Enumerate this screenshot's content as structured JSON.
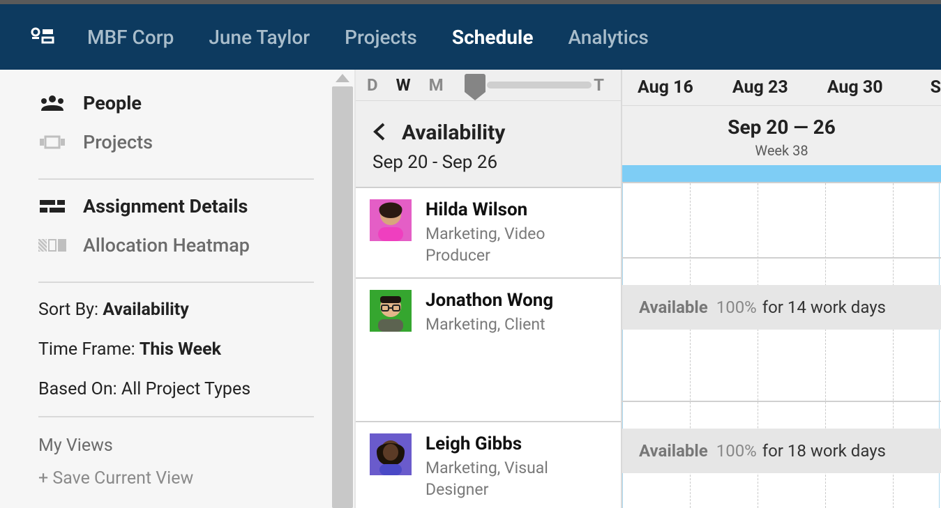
{
  "topnav": {
    "items": [
      {
        "label": "MBF Corp"
      },
      {
        "label": "June Taylor"
      },
      {
        "label": "Projects"
      },
      {
        "label": "Schedule",
        "active": true
      },
      {
        "label": "Analytics"
      }
    ]
  },
  "sidebar": {
    "items": [
      {
        "label": "People",
        "active": true
      },
      {
        "label": "Projects"
      },
      {
        "label": "Assignment Details",
        "active": true
      },
      {
        "label": "Allocation Heatmap"
      }
    ],
    "sort": {
      "label": "Sort By: ",
      "value": "Availability"
    },
    "timeframe": {
      "label": "Time Frame: ",
      "value": "This Week"
    },
    "basedon": {
      "label": "Based On: All Project Types"
    },
    "myviews": "My Views",
    "save": "+ Save Current View"
  },
  "zoom": {
    "letters": [
      "D",
      "W",
      "M"
    ],
    "active": "W",
    "today_label": "T"
  },
  "timeline": {
    "dates": [
      "Aug 16",
      "Aug 23",
      "Aug 30"
    ],
    "trailing": "S",
    "header_title": "Sep 20 — 26",
    "header_sub": "Week 38"
  },
  "panel": {
    "title": "Availability",
    "range": "Sep 20 - Sep 26"
  },
  "people": [
    {
      "name": "Hilda Wilson",
      "role": "Marketing, Video Producer",
      "avatar_bg": "#e45ec6",
      "skin": "#d7a67d"
    },
    {
      "name": "Jonathon Wong",
      "role": "Marketing, Client",
      "avatar_bg": "#35a62f",
      "skin": "#e3b68a",
      "availability": {
        "label": "Available",
        "pct": "100%",
        "rest": "for 14 work days"
      }
    },
    {
      "name": "Leigh Gibbs",
      "role": "Marketing, Visual Designer",
      "avatar_bg": "#6a5bcc",
      "skin": "#5b3b26",
      "availability": {
        "label": "Available",
        "pct": "100%",
        "rest": "for 18 work days"
      }
    }
  ]
}
